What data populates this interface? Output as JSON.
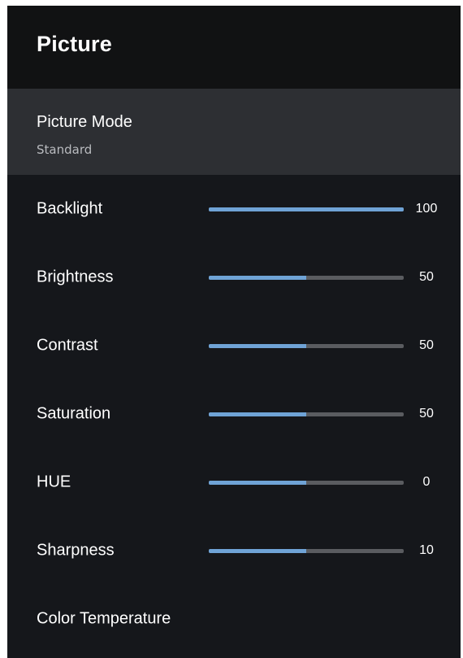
{
  "header": {
    "title": "Picture"
  },
  "picture_mode": {
    "label": "Picture Mode",
    "value": "Standard"
  },
  "sliders": [
    {
      "label": "Backlight",
      "value": "100",
      "level": 1.0
    },
    {
      "label": "Brightness",
      "value": "50",
      "level": 0.5
    },
    {
      "label": "Contrast",
      "value": "50",
      "level": 0.5
    },
    {
      "label": "Saturation",
      "value": "50",
      "level": 0.5
    },
    {
      "label": "HUE",
      "value": "0",
      "level": 0.5
    },
    {
      "label": "Sharpness",
      "value": "10",
      "level": 0.5
    }
  ],
  "color_temperature": {
    "label": "Color Temperature"
  },
  "colors": {
    "panel_bg": "#15171b",
    "header_bg": "#111213",
    "selected_bg": "#2d2f33",
    "slider_fill": "#6fa3d6",
    "slider_track": "#5a5c60"
  }
}
